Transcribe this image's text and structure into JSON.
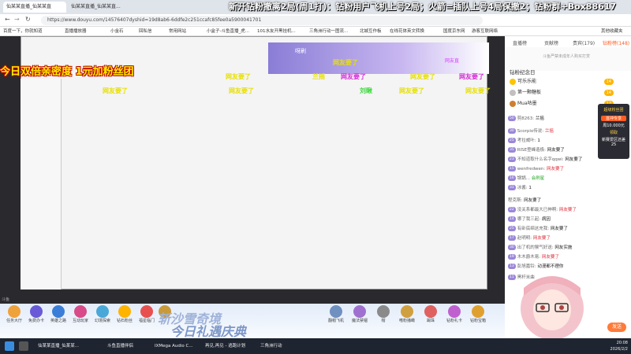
{
  "banner": "新开钻粉撤离2局(周1打)：钻粉用户飞机上号2局；火箭=插队上号4局保撤2；钻粉群+Box88617",
  "browser": {
    "tabs": [
      "仙某某直播_仙某某直",
      "仙某某直播_仙某某直..."
    ],
    "url": "https://www.douyu.com/14576407dyshid=19d8ab6-6ddfe2c251ccafc85fee0a5900041701",
    "bookmarks": [
      "百度一下，你就知道",
      "直播播放器",
      "小金石",
      "回私信",
      "常用网站",
      "小盒子-斗鱼直播_虎...",
      "101水友开黑挂机...",
      "三角洲行动一图流...",
      "北城互作板",
      "在线花体英文转换",
      "国度京东网",
      "游客互联网络",
      "其他收藏夹"
    ]
  },
  "stream": {
    "promo": "今日双倍亲密度 1元加粉丝团",
    "stage_name": "呀刷",
    "gift_banner": "网友直",
    "danmaku": [
      {
        "text": "网友要了",
        "color": "#e8e000"
      },
      {
        "text": "网友要了",
        "color": "#e8e000"
      },
      {
        "text": "网友要了",
        "color": "#d42ad8"
      },
      {
        "text": "网友要了",
        "color": "#e8e000"
      },
      {
        "text": "网友要了",
        "color": "#e8e000"
      },
      {
        "text": "兰摇",
        "color": "#e8e000"
      },
      {
        "text": "网友要了",
        "color": "#e8e000"
      },
      {
        "text": "网友要了",
        "color": "#d42ad8"
      },
      {
        "text": "网友要了",
        "color": "#e8e000"
      },
      {
        "text": "刘瞅",
        "color": "#3ad83a"
      },
      {
        "text": "网友要了",
        "color": "#e8e000"
      }
    ],
    "fps": "斗鱼"
  },
  "gift_bar": {
    "items": [
      "任务大厅",
      "免费办卡",
      "英雄之路",
      "互动玩家",
      "幻境探索",
      "钻石粉丝",
      "福星临门",
      "沙漠通宵"
    ],
    "event_title": "斩沙雪奇境",
    "event_sub": "今日礼遇庆典",
    "right_items": [
      "翻帽飞机",
      "魔法禁锢",
      "帽",
      "嗜粉播瞰",
      "踢珠",
      "钻粉礼卡",
      "钻粉宝箱"
    ]
  },
  "right_panel": {
    "tabs": [
      "直播榜",
      "贡献榜",
      "贵宾(179)",
      "钻粉榜(148)"
    ],
    "rank_text": "斗鱼严禁未成年人购买打赏",
    "fans_head": "钻粉纪念日",
    "ranks": [
      {
        "name": "可乐乐能",
        "badge": "14"
      },
      {
        "name": "第一颗糖板",
        "badge": "14"
      },
      {
        "name": "Mua咕墨",
        "badge": "12"
      }
    ],
    "side_box": {
      "title": "超级粉丝团",
      "line1": "首冲专享",
      "line2": "周10.000元",
      "line3": "领取",
      "line4": "新赛爱区还差",
      "line5": "25"
    },
    "chat": [
      {
        "lv": "50",
        "name": "剪8263:",
        "msg": "兰摇",
        "red": false
      },
      {
        "lv": "30",
        "name": "Scorpio传说:",
        "msg": "兰摇",
        "red": true
      },
      {
        "lv": "25",
        "name": "考拉威叶:",
        "msg": "1",
        "red": false
      },
      {
        "lv": "35",
        "name": "RISE登峰造极:",
        "msg": "网友要了",
        "red": false
      },
      {
        "lv": "23",
        "name": "不知道取什么名字qqwi:",
        "msg": "网友要了",
        "red": false
      },
      {
        "lv": "15",
        "name": "wenfredwen:",
        "msg": "网友要了",
        "red": true
      },
      {
        "lv": "16",
        "name": "锅锅...",
        "msg": "会刷星",
        "red": false
      },
      {
        "lv": "31",
        "name": "冰酱:",
        "msg": "1",
        "red": false
      },
      {
        "lv": "",
        "name": "程克斯:",
        "msg": "网友要了",
        "red": false
      },
      {
        "lv": "22",
        "name": "没关系都最大已神啊:",
        "msg": "网友要了",
        "red": true
      },
      {
        "lv": "14",
        "name": "哪了我三起:",
        "msg": "病因",
        "red": false
      },
      {
        "lv": "25",
        "name": "有卧底绵这充我:",
        "msg": "网友要了",
        "red": false
      },
      {
        "lv": "17",
        "name": "赵明明:",
        "msg": "网友要了",
        "red": true
      },
      {
        "lv": "30",
        "name": "出了机的猴气好送:",
        "msg": "网友实施",
        "red": false
      },
      {
        "lv": "19",
        "name": "木木爵木易:",
        "msg": "网友要了",
        "red": true
      },
      {
        "lv": "13",
        "name": "彭旭嘉铃:",
        "msg": "动漫都不理你",
        "red": false
      },
      {
        "lv": "11",
        "name": "黑杆米曲",
        "msg": "",
        "red": false
      }
    ],
    "send": "发送"
  },
  "taskbar": {
    "apps": [
      "仙某某直播_仙某某...",
      "仙某某直播_仙某某...",
      "斗鱼直播伴侣",
      "IXMega Audio C...",
      "再见,再见 - 逃跑计划",
      "三角洲行动"
    ],
    "time": "20:08",
    "date": "2026/2/2"
  }
}
